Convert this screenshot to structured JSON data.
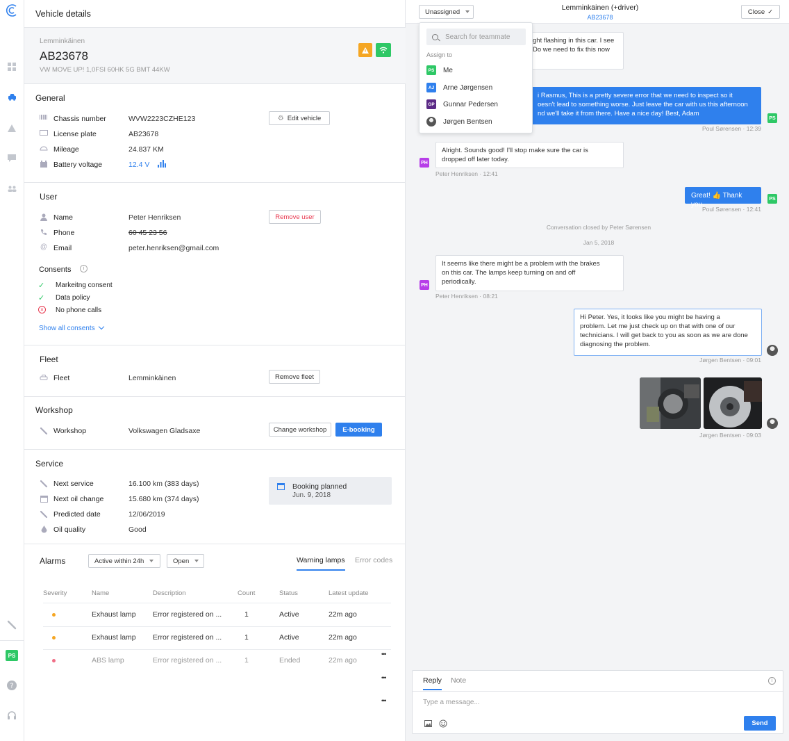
{
  "rail": {
    "user_initials": "PS"
  },
  "vehicle": {
    "panel_title": "Vehicle details",
    "owner": "Lemminkäinen",
    "plate": "AB23678",
    "model": "VW MOVE UP! 1,0FSI 60HK 5G BMT 44KW",
    "general": {
      "title": "General",
      "edit_button": "Edit vehicle",
      "rows": [
        {
          "label": "Chassis number",
          "value": "WVW2223CZHE123",
          "icon": "barcode-icon"
        },
        {
          "label": "License plate",
          "value": "AB23678",
          "icon": "license-plate-icon"
        },
        {
          "label": "Mileage",
          "value": "24.837 KM",
          "icon": "speedometer-icon"
        },
        {
          "label": "Battery voltage",
          "value": "12.4 V",
          "icon": "battery-icon"
        }
      ]
    },
    "user": {
      "title": "User",
      "remove_button": "Remove user",
      "rows": [
        {
          "label": "Name",
          "value": "Peter Henriksen",
          "icon": "person-icon"
        },
        {
          "label": "Phone",
          "value": "60 45 23 56",
          "icon": "phone-icon"
        },
        {
          "label": "Email",
          "value": "peter.henriksen@gmail.com",
          "icon": "at-icon"
        }
      ],
      "consents_title": "Consents",
      "consents": [
        {
          "label": "Markeitng consent",
          "status": "granted"
        },
        {
          "label": "Data policy",
          "status": "granted"
        },
        {
          "label": "No phone calls",
          "status": "denied"
        }
      ],
      "show_all": "Show all consents"
    },
    "fleet": {
      "title": "Fleet",
      "label": "Fleet",
      "value": "Lemminkäinen",
      "remove_button": "Remove fleet"
    },
    "workshop": {
      "title": "Workshop",
      "label": "Workshop",
      "value": "Volkswagen Gladsaxe",
      "change_button": "Change workshop",
      "ebooking_button": "E-booking"
    },
    "service": {
      "title": "Service",
      "rows": [
        {
          "label": "Next service",
          "value": "16.100 km (383 days)",
          "icon": "wrench-icon"
        },
        {
          "label": "Next oil change",
          "value": "15.680 km (374 days)",
          "icon": "calendar-icon"
        },
        {
          "label": "Predicted date",
          "value": "12/06/2019",
          "icon": "wrench-icon"
        },
        {
          "label": "Oil quality",
          "value": "Good",
          "icon": "oil-drop-icon"
        }
      ],
      "booking_title": "Booking planned",
      "booking_date": "Jun. 9, 2018"
    },
    "alarms": {
      "title": "Alarms",
      "filter_time": "Active within 24h",
      "filter_status": "Open",
      "tab_warning": "Warning lamps",
      "tab_errors": "Error codes",
      "columns": [
        "Severity",
        "Name",
        "Description",
        "Count",
        "Status",
        "Latest update"
      ],
      "rows": [
        {
          "severity_color": "#f5a623",
          "name": "Exhaust lamp",
          "description": "Error registered on ...",
          "count": "1",
          "status": "Active",
          "updated": "22m ago",
          "muted": false
        },
        {
          "severity_color": "#f5a623",
          "name": "Exhaust lamp",
          "description": "Error registered on ...",
          "count": "1",
          "status": "Active",
          "updated": "22m ago",
          "muted": false
        },
        {
          "severity_color": "#f06e86",
          "name": "ABS lamp",
          "description": "Error registered on ...",
          "count": "1",
          "status": "Ended",
          "updated": "22m ago",
          "muted": true
        }
      ],
      "more": "•••"
    }
  },
  "chat": {
    "assign_dropdown": "Unassigned",
    "header_title": "Lemminkäinen (+driver)",
    "header_plate": "AB23678",
    "close_button": "Close",
    "assign_menu": {
      "search_placeholder": "Search for teammate",
      "section": "Assign to",
      "items": [
        {
          "initials": "PS",
          "name": "Me",
          "color": "#2ec866"
        },
        {
          "initials": "AJ",
          "name": "Arne Jørgensen",
          "color": "#2f80ed"
        },
        {
          "initials": "GP",
          "name": "Gunnar Pedersen",
          "color": "#5b2a86"
        },
        {
          "initials": "",
          "name": "Jørgen Bentsen",
          "color": "#555555"
        }
      ]
    },
    "messages": {
      "m1": "ght flashing in this car. I see\nDo we need to fix this now",
      "m2": "i Rasmus, This is a pretty severe error that we need to inspect so it\noesn't lead to something worse. Just leave the car with us this afternoon\nnd we'll take it from there. Have a nice day! Best, Adam",
      "m2_meta": "Poul Sørensen · 12:39",
      "m3": "Alright. Sounds good! I'll stop make sure the car is\ndropped off later today.",
      "m3_meta": "Peter Henriksen · 12:41",
      "m4": "Great! 👍 Thank you.",
      "m4_meta": "Poul Sørensen · 12:41",
      "closed_note": "Conversation closed by Peter Sørensen",
      "date_sep": "Jan 5, 2018",
      "m5": "It seems like there might be a problem with the brakes\non this car. The lamps keep turning on and off\nperiodically.",
      "m5_meta": "Peter Henriksen · 08:21",
      "m6": "Hi Peter. Yes, it looks like you might be having a\nproblem. Let me just check up on that with one of our\ntechnicians. I will get back to you as soon as we are done\ndiagnosing the problem.",
      "m6_meta": "Jørgen Bentsen · 09:01",
      "m7_meta": "Jørgen Bentsen · 09:03"
    },
    "composer": {
      "tab_reply": "Reply",
      "tab_note": "Note",
      "placeholder": "Type a message...",
      "send": "Send"
    }
  },
  "colors": {
    "accent": "#2f80ed",
    "green": "#2ec866",
    "warning": "#f5a623",
    "danger": "#e8384f"
  }
}
